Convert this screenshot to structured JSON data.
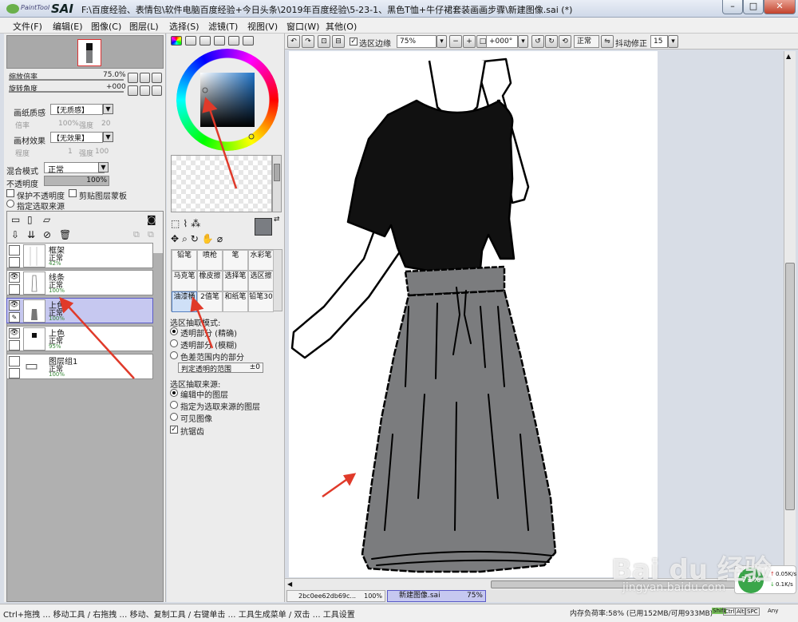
{
  "app": {
    "logo_small": "PaintTool",
    "logo_big": "SAI",
    "title": "F:\\百度经验、表情包\\软件电脑百度经验+今日头条\\2019年百度经验\\5-23-1、黑色T恤+牛仔裙套装画画步骤\\新建图像.sai (*)"
  },
  "window_controls": {
    "minimize": "–",
    "maximize": "□",
    "close": "✕"
  },
  "menu": [
    "文件(F)",
    "编辑(E)",
    "图像(C)",
    "图层(L)",
    "选择(S)",
    "滤镜(T)",
    "视图(V)",
    "窗口(W)",
    "其他(O)"
  ],
  "navigator": {
    "zoom_label": "缩放倍率",
    "zoom_value": "75.0%",
    "rotate_label": "旋转角度",
    "rotate_value": "+000"
  },
  "paper": {
    "texture_label": "画纸质感",
    "texture_value": "【无质感】",
    "scale_label": "倍率",
    "scale_value": "100%",
    "strength_label": "强度",
    "strength_value": "20",
    "effect_label": "画材效果",
    "effect_value": "【无效果】",
    "width_label": "程度",
    "width_value": "1",
    "effect_strength_label": "强度",
    "effect_strength_value": "100"
  },
  "blend": {
    "mode_label": "混合模式",
    "mode_value": "正常",
    "opacity_label": "不透明度",
    "opacity_value": "100%",
    "protect_opacity": "保护不透明度",
    "clipping_group": "剪贴图层蒙板",
    "selection_source": "指定选取来源"
  },
  "layers": [
    {
      "name": "框架",
      "mode": "正常",
      "opacity": "42%",
      "visible": false,
      "selected": false
    },
    {
      "name": "线条",
      "mode": "正常",
      "opacity": "100%",
      "visible": true,
      "selected": false
    },
    {
      "name": "上色2",
      "mode": "正常",
      "opacity": "100%",
      "visible": true,
      "selected": true
    },
    {
      "name": "上色",
      "mode": "正常",
      "opacity": "95%",
      "visible": true,
      "selected": false
    },
    {
      "name": "图层组1",
      "mode": "正常",
      "opacity": "100%",
      "visible": false,
      "selected": false
    }
  ],
  "brushes": [
    [
      "铅笔",
      "喷枪",
      "笔",
      "水彩笔"
    ],
    [
      "马克笔",
      "橡皮擦",
      "选择笔",
      "选区擦"
    ],
    [
      "油漆桶",
      "2值笔",
      "和纸笔",
      "铅笔30"
    ]
  ],
  "bucket_options": {
    "extract_label": "选区抽取模式:",
    "extract_options": [
      "透明部分 (精确)",
      "透明部分 (模糊)",
      "色差范围内的部分"
    ],
    "extract_selected": 0,
    "range_label": "判定透明的范围",
    "range_value": "±0",
    "source_label": "选区抽取来源:",
    "source_options": [
      "编辑中的图层",
      "指定为选取来源的图层",
      "可见图像"
    ],
    "source_selected": 0,
    "antialias_label": "抗锯齿"
  },
  "canvas_toolbar": {
    "selection_edge": "选区边缘",
    "zoom": "75%",
    "angle": "+000°",
    "mode": "正常",
    "stabilizer_label": "抖动修正",
    "stabilizer_value": "15"
  },
  "tabs": [
    {
      "name": "2bc0ee62db69c...",
      "zoom": "100%"
    },
    {
      "name": "新建图像.sai",
      "zoom": "75%"
    }
  ],
  "status": {
    "hints": "Ctrl+拖拽 … 移动工具 / 右拖拽 … 移动、复制工具 / 右键单击 … 工具生成菜单 / 双击 … 工具设置",
    "memory": "内存负荷率:58% (已用152MB/可用933MB)",
    "keys": [
      "Shift",
      "Ctrl",
      "Alt",
      "SPC",
      "Any"
    ]
  },
  "net_widget": {
    "percent": "71%",
    "up": "0.05K/s",
    "down": "0.1K/s"
  },
  "watermark": {
    "brand": "Bai du 经验",
    "url": "jingyan.baidu.com"
  },
  "colors": {
    "shirt": "#111111",
    "skirt": "#7b7c7e",
    "selected_layer": "#c6c8f0",
    "arrow": "#e03a2a",
    "hue_ring": "rainbow"
  }
}
